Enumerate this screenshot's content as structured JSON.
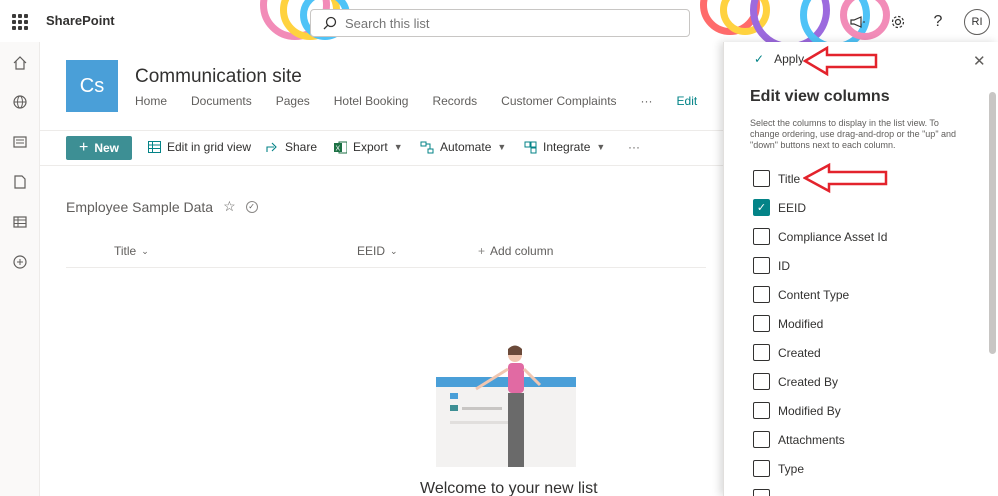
{
  "suite": {
    "brand": "SharePoint",
    "search_placeholder": "Search this list",
    "avatar_initials": "RI"
  },
  "site": {
    "logo": "Cs",
    "title": "Communication site",
    "nav": [
      "Home",
      "Documents",
      "Pages",
      "Hotel Booking",
      "Records",
      "Customer Complaints"
    ],
    "nav_more": "···",
    "nav_edit": "Edit"
  },
  "commands": {
    "new": "New",
    "edit_grid": "Edit in grid view",
    "share": "Share",
    "export": "Export",
    "automate": "Automate",
    "integrate": "Integrate",
    "more": "···"
  },
  "list": {
    "title": "Employee Sample Data",
    "columns": [
      "Title",
      "EEID"
    ],
    "add_column": "Add column",
    "welcome": "Welcome to your new list"
  },
  "panel": {
    "apply": "Apply",
    "title": "Edit view columns",
    "description": "Select the columns to display in the list view. To change ordering, use drag-and-drop or the \"up\" and \"down\" buttons next to each column.",
    "columns": [
      {
        "label": "Title",
        "checked": false
      },
      {
        "label": "EEID",
        "checked": true
      },
      {
        "label": "Compliance Asset Id",
        "checked": false
      },
      {
        "label": "ID",
        "checked": false
      },
      {
        "label": "Content Type",
        "checked": false
      },
      {
        "label": "Modified",
        "checked": false
      },
      {
        "label": "Created",
        "checked": false
      },
      {
        "label": "Created By",
        "checked": false
      },
      {
        "label": "Modified By",
        "checked": false
      },
      {
        "label": "Attachments",
        "checked": false
      },
      {
        "label": "Type",
        "checked": false
      }
    ]
  },
  "colors": {
    "accent": "#038387",
    "new_button": "#3d8f94",
    "annotation": "#e3232c"
  }
}
